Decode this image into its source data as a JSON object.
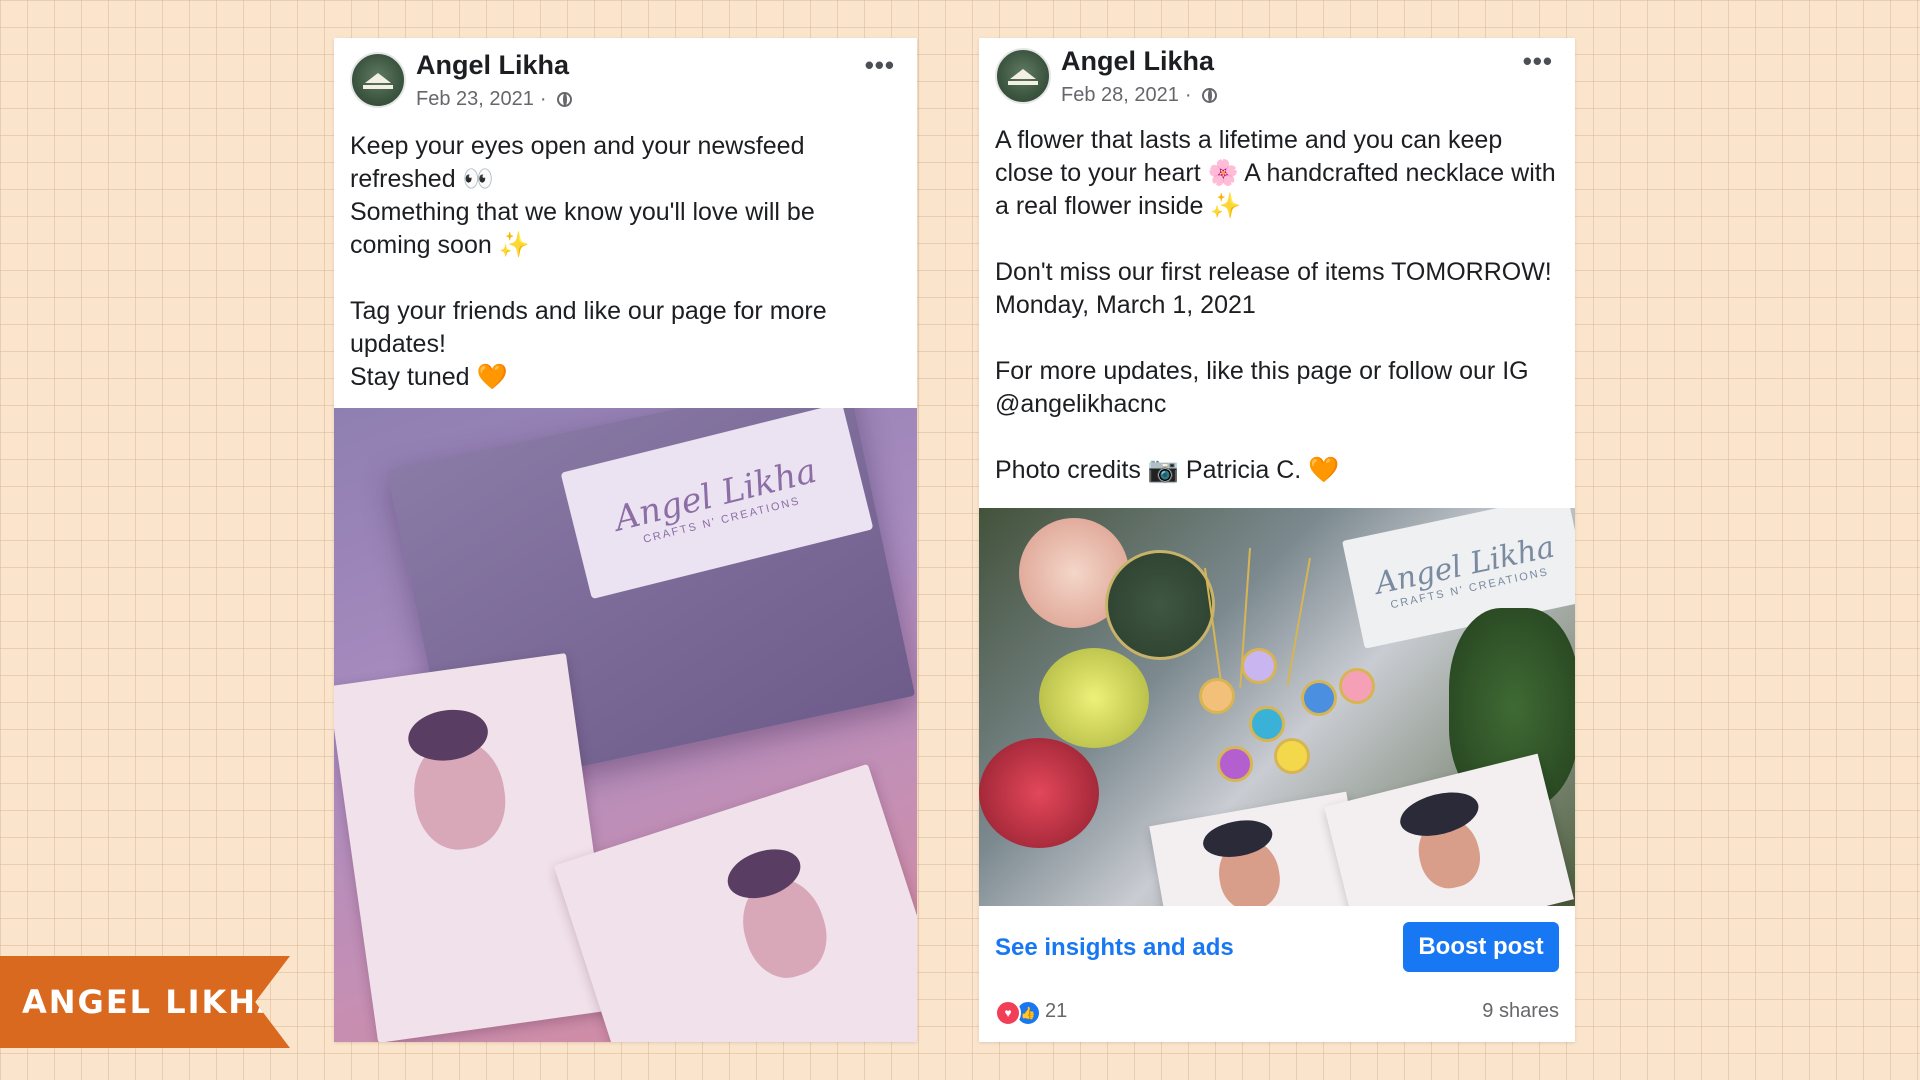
{
  "brand": {
    "ribbon_label": "ANGEL LIKHA"
  },
  "posts": [
    {
      "author": "Angel Likha",
      "date": "Feb 23, 2021",
      "separator": "·",
      "more": "•••",
      "text_lines": [
        "Keep your eyes open and your newsfeed refreshed 👀",
        "Something that we know you'll love will be coming soon ✨",
        "",
        "Tag your friends and like our page for more updates!",
        "Stay tuned 🧡"
      ],
      "photo": {
        "label_script": "Angel Likha",
        "label_sub": "CRAFTS N' CREATIONS"
      }
    },
    {
      "author": "Angel Likha",
      "date": "Feb 28, 2021",
      "separator": "·",
      "more": "•••",
      "text_lines": [
        "A flower that lasts a lifetime and you can keep close to your heart 🌸 A handcrafted necklace with a real flower inside ✨",
        "",
        "Don't miss our first release of items TOMORROW! Monday, March 1, 2021",
        "",
        "For more updates, like this page or follow our IG @angelikhacnc",
        "",
        "Photo credits 📷 Patricia C. 🧡"
      ],
      "photo": {
        "label_script": "Angel Likha",
        "label_sub": "CRAFTS N' CREATIONS"
      },
      "insights_label": "See insights and ads",
      "boost_label": "Boost post",
      "reaction_count": "21",
      "shares_label": "9 shares"
    }
  ],
  "colors": {
    "background": "#fbe4cc",
    "link_blue": "#1877f2",
    "ribbon_orange": "#d9691f"
  },
  "icons": [
    "globe-icon",
    "more-options-icon",
    "love-reaction-icon",
    "like-reaction-icon"
  ]
}
